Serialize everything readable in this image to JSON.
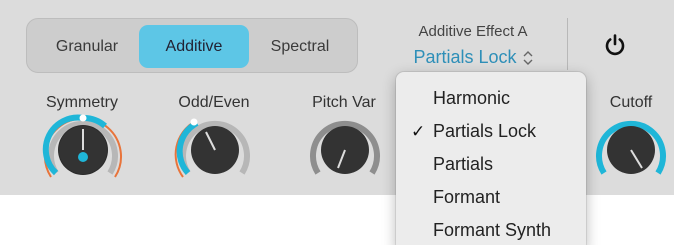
{
  "synth_mode": {
    "options": [
      "Granular",
      "Additive",
      "Spectral"
    ],
    "selected": "Additive"
  },
  "effect": {
    "title": "Additive Effect A",
    "value": "Partials Lock"
  },
  "knobs": [
    {
      "label": "Symmetry"
    },
    {
      "label": "Odd/Even"
    },
    {
      "label": "Pitch Var"
    },
    {
      "label": "Cutoff"
    }
  ],
  "menu": {
    "items": [
      "Harmonic",
      "Partials Lock",
      "Partials",
      "Formant",
      "Formant Synth"
    ],
    "checked": "Partials Lock"
  },
  "colors": {
    "accent": "#5dc6e6",
    "selected_text": "#2e8fb8",
    "mod_ring": "#e8743b",
    "knob_track": "#1fb6d8"
  },
  "icons": [
    "power-icon",
    "updown-chevron-icon",
    "checkmark-icon"
  ]
}
